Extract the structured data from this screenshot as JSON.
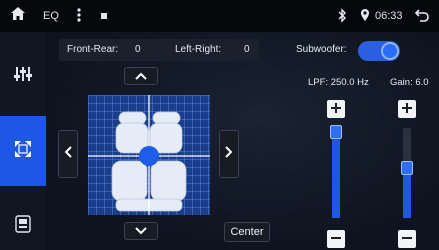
{
  "statusbar": {
    "app_label": "EQ",
    "time": "06:33",
    "icons": [
      "home-icon",
      "more-vertical-icon",
      "notification-icon",
      "bluetooth-icon",
      "location-icon",
      "back-icon"
    ]
  },
  "sidebar": {
    "items": [
      {
        "name": "equalizer",
        "icon": "equalizer-sliders-icon",
        "active": false
      },
      {
        "name": "balance",
        "icon": "balance-arrows-icon",
        "active": true
      },
      {
        "name": "sound-settings",
        "icon": "speaker-settings-icon",
        "active": false
      }
    ]
  },
  "balance": {
    "front_rear_label": "Front-Rear:",
    "front_rear_value": "0",
    "left_right_label": "Left-Right:",
    "left_right_value": "0",
    "center_label": "Center"
  },
  "subwoofer": {
    "label": "Subwoofer:",
    "enabled": true,
    "lpf_label": "LPF: 250.0 Hz",
    "gain_label": "Gain: 6.0",
    "lpf_level": 0.93,
    "gain_level": 0.55
  },
  "colors": {
    "accent": "#1e56e6",
    "background": "#0b0f18",
    "grid": "#1a3e8c"
  }
}
